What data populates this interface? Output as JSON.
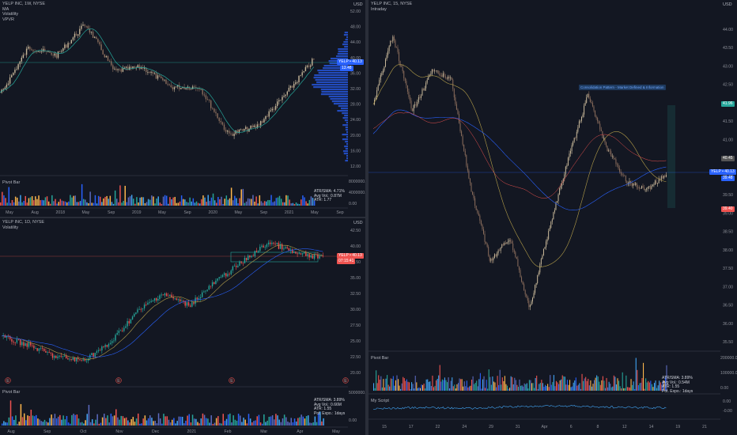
{
  "pane1": {
    "header": [
      "YELP INC, 1W, NYSE",
      "MA",
      "Volatility",
      "VPVR"
    ],
    "currency": "USD",
    "price_ticks": [
      "52.00",
      "48.00",
      "44.00",
      "40.00",
      "36.00",
      "32.00",
      "28.00",
      "24.00",
      "20.00",
      "16.00",
      "12.00"
    ],
    "time_ticks": [
      "May",
      "Aug",
      "2018",
      "May",
      "Sep",
      "2019",
      "May",
      "Sep",
      "2020",
      "May",
      "Sep",
      "2021",
      "May",
      "Sep"
    ],
    "price_tag": "YELP • 40.13",
    "price_tag2": "13.48",
    "vol_label": "Pivot Bar",
    "vol_ticks": [
      "8000000.00",
      "4000000.00",
      "0.00"
    ],
    "stats": "ATR/SMA: 4.71%\nAvg Vol.: 0.87M\nATR: 1.77",
    "colors": {
      "up": "#26a69a",
      "down": "#ef5350",
      "candle": "#c8b89a",
      "vpvr": "#2962ff"
    }
  },
  "pane2": {
    "header": [
      "YELP INC, 1D, NYSE",
      "Volatility"
    ],
    "currency": "USD",
    "price_ticks": [
      "42.50",
      "40.00",
      "37.50",
      "35.00",
      "32.50",
      "30.00",
      "27.50",
      "25.00",
      "22.50",
      "20.00"
    ],
    "time_ticks": [
      "Aug",
      "Sep",
      "Oct",
      "Nov",
      "Dec",
      "2021",
      "Feb",
      "Mar",
      "Apr",
      "May"
    ],
    "price_tag": "YELP • 40.13",
    "price_tag2": "07:15:41",
    "vol_label": "Pivot Bar",
    "vol_ticks": [
      "5000000.00",
      "0.00"
    ],
    "stats": "ATR/SMA: 3.89%\nAvg Vol.: 0.66M\nATR: 1.55\nPot. Expo.: 1days",
    "event_markers": [
      "E",
      "E",
      "E",
      "E"
    ]
  },
  "pane3": {
    "header": [
      "YELP INC, 15, NYSE",
      "Intraday"
    ],
    "currency": "USD",
    "price_ticks": [
      "44.00",
      "43.50",
      "43.00",
      "42.50",
      "42.00",
      "41.50",
      "41.00",
      "40.50",
      "40.00",
      "39.50",
      "39.00",
      "38.50",
      "38.00",
      "37.50",
      "37.00",
      "36.50",
      "36.00",
      "35.50"
    ],
    "time_ticks": [
      "15",
      "17",
      "22",
      "24",
      "29",
      "31",
      "Apr",
      "6",
      "8",
      "12",
      "14",
      "19",
      "21"
    ],
    "price_tag": "YELP • 40.13",
    "price_tag2": "39.48",
    "side_tags": [
      "41.96",
      "40.45",
      "39.40"
    ],
    "annotation": "Consolidation Pattern - Market Defined & Information",
    "vol_label": "Pivot Bar",
    "vol_ticks": [
      "200000.00",
      "100000.00",
      "0.00"
    ],
    "stats": "ATR/SMA: 3.89%\nAvg Vol.: 0.54M\nATR: 1.55\nPot. Expo.: 1days",
    "script_label": "My Script",
    "script_ticks": [
      "0.00",
      "-0.00"
    ]
  }
}
